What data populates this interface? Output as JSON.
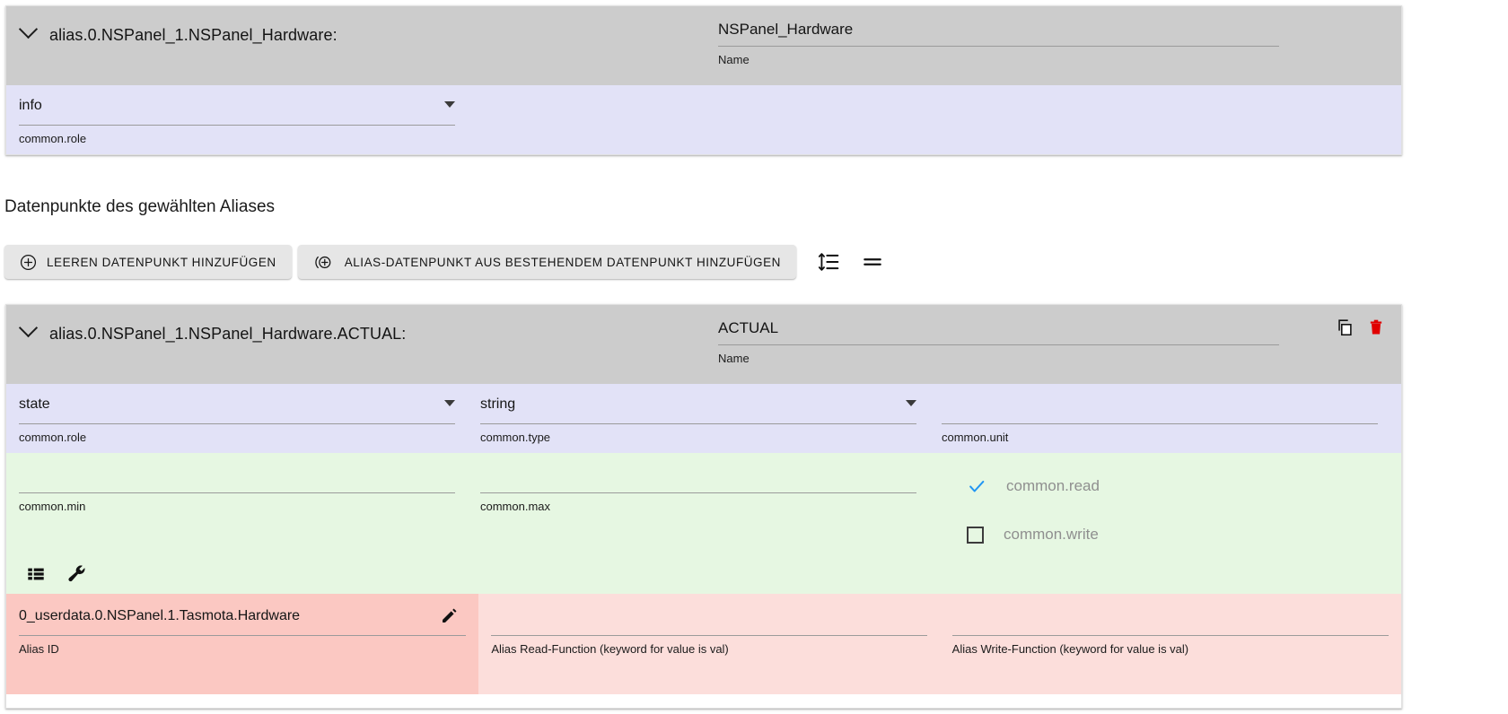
{
  "alias_panel": {
    "title": "alias.0.NSPanel_1.NSPanel_Hardware:",
    "name_value": "NSPanel_Hardware",
    "name_label": "Name",
    "role_value": "info",
    "role_label": "common.role",
    "expander_icon": "chevron-down-icon"
  },
  "section": {
    "title": "Datenpunkte des gewählten Aliases"
  },
  "toolbar": {
    "add_empty_label": "LEEREN DATENPUNKT HINZUFÜGEN",
    "add_empty_icon": "plus-circle-icon",
    "add_existing_label": "ALIAS-DATENPUNKT AUS BESTEHENDEM DATENPUNKT HINZUFÜGEN",
    "add_existing_icon": "plus-circle-parens-icon",
    "sort_icon": "format-line-spacing-icon",
    "equals_icon": "equals-icon"
  },
  "datapoint": {
    "title": "alias.0.NSPanel_1.NSPanel_Hardware.ACTUAL:",
    "name_value": "ACTUAL",
    "name_label": "Name",
    "copy_icon": "copy-icon",
    "delete_icon": "trash-icon",
    "delete_color": "#e00000",
    "expander_icon": "chevron-down-icon",
    "fields": {
      "role_value": "state",
      "role_label": "common.role",
      "type_value": "string",
      "type_label": "common.type",
      "unit_value": "",
      "unit_label": "common.unit",
      "min_value": "",
      "min_label": "common.min",
      "max_value": "",
      "max_label": "common.max"
    },
    "checks": [
      {
        "label": "common.read",
        "checked": true,
        "icon": "check-icon",
        "color": "#2196f3"
      },
      {
        "label": "common.write",
        "checked": false,
        "icon": "checkbox-empty-icon"
      }
    ],
    "utility_icons": [
      {
        "name": "list-icon"
      },
      {
        "name": "wrench-icon"
      }
    ],
    "alias": {
      "id_value": "0_userdata.0.NSPanel.1.Tasmota.Hardware",
      "id_label": "Alias ID",
      "edit_icon": "pencil-icon",
      "read_fn_value": "",
      "read_fn_label": "Alias Read-Function (keyword for value is val)",
      "write_fn_value": "",
      "write_fn_label": "Alias Write-Function (keyword for value is val)"
    }
  }
}
